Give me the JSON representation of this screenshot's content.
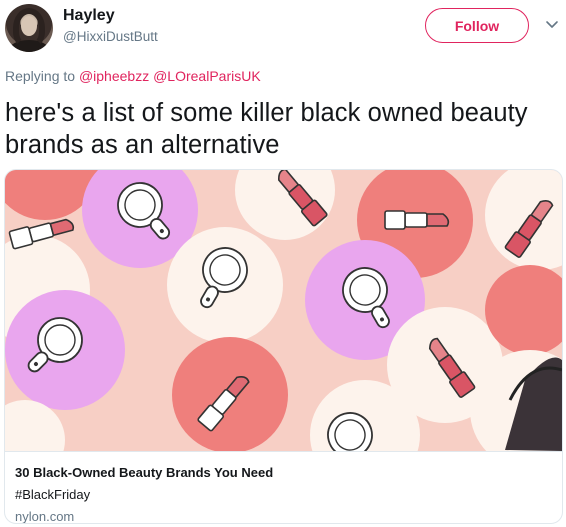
{
  "user": {
    "name": "Hayley",
    "handle": "@HixxiDustButt"
  },
  "follow_button": {
    "label": "Follow"
  },
  "menu": {
    "icon": "chevron-down-icon"
  },
  "reply": {
    "prefix": "Replying to",
    "mentions": [
      "@ipheebzz",
      "@LOrealParisUK"
    ]
  },
  "tweet": {
    "text": "here's a list of some killer black owned beauty brands as an alternative"
  },
  "card": {
    "title": "30 Black-Owned Beauty Brands You Need",
    "description": "#BlackFriday",
    "domain": "nylon.com"
  },
  "colors": {
    "accent": "#e0245e",
    "muted": "#657786",
    "card_bg": "#f7cfc5",
    "circle_cream": "#fdf3ec",
    "circle_pink": "#ef7f7c",
    "circle_lavender": "#e9a6ee"
  }
}
